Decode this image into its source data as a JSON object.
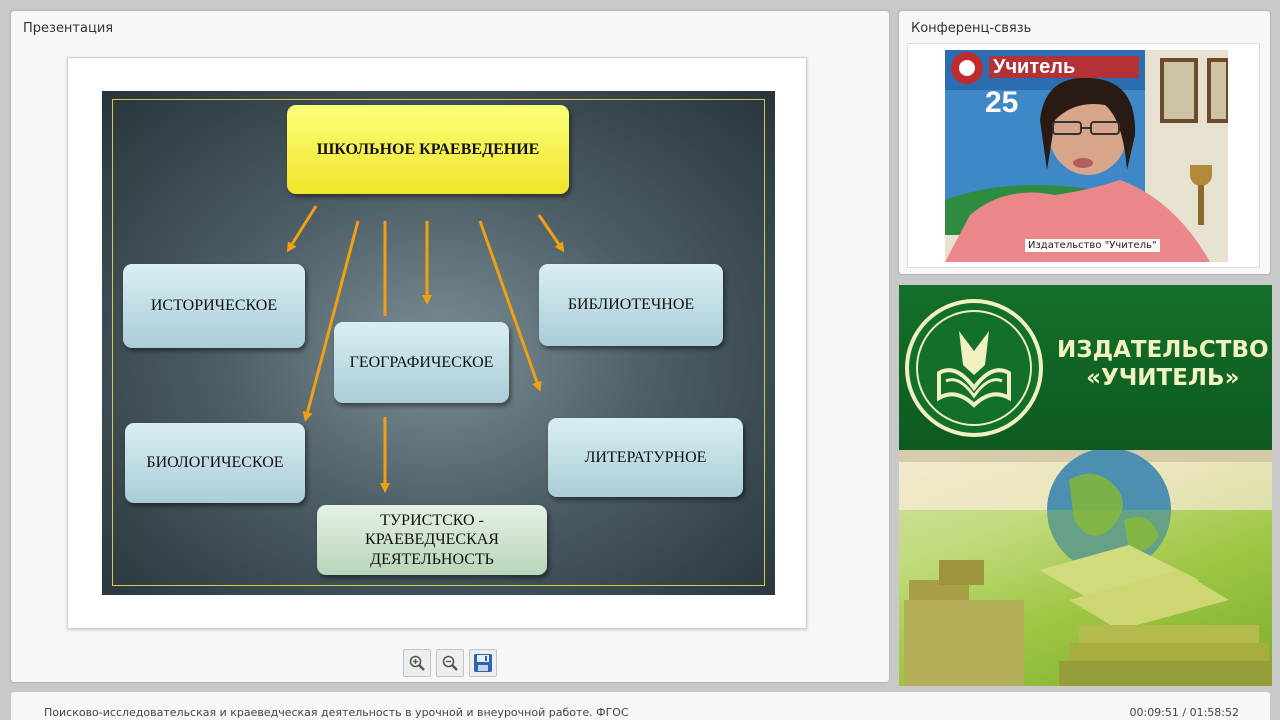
{
  "presentation": {
    "title": "Презентация",
    "slide": {
      "title_box": "ШКОЛЬНОЕ КРАЕВЕДЕНИЕ",
      "boxes": {
        "historical": "ИСТОРИЧЕСКОЕ",
        "geographic": "ГЕОГРАФИЧЕСКОЕ",
        "library": "БИБЛИОТЕЧНОЕ",
        "biological": "БИОЛОГИЧЕСКОЕ",
        "literary": "ЛИТЕРАТУРНОЕ",
        "tourism_line1": "ТУРИСТСКО -",
        "tourism_line2": "КРАЕВЕДЧЕСКАЯ",
        "tourism_line3": "ДЕЯТЕЛЬНОСТЬ"
      }
    },
    "toolbar": {
      "zoom_in_icon": "zoom-in-icon",
      "zoom_out_icon": "zoom-out-icon",
      "save_icon": "floppy-disk-icon"
    }
  },
  "conference": {
    "title": "Конференц-связь",
    "video_caption": "Издательство \"Учитель\""
  },
  "banner": {
    "line1": "ИЗДАТЕЛЬСТВО",
    "line2": "«УЧИТЕЛЬ»"
  },
  "footer": {
    "title": "Поисково-исследовательская и краеведческая деятельность в урочной и внеурочной работе. ФГОС",
    "time": "00:09:51 / 01:58:52"
  },
  "colors": {
    "banner_green": "#13702a",
    "title_box_yellow": "#f7f045",
    "arrow_orange": "#f0a010"
  }
}
